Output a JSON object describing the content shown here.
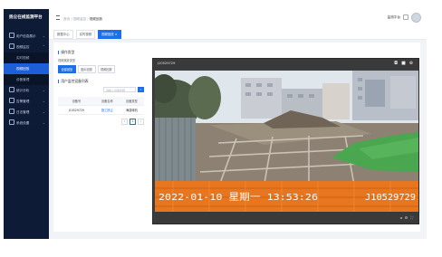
{
  "app": {
    "title": "扬尘在线监测平台"
  },
  "sidebar": {
    "items": [
      {
        "icon": "home-icon",
        "label": "用户信息展示",
        "sub": []
      },
      {
        "icon": "monitor-icon",
        "label": "视频监控",
        "sub": [
          {
            "label": "实时视频",
            "active": false
          },
          {
            "label": "视频回放",
            "active": true
          },
          {
            "label": "设备管理",
            "active": false
          }
        ]
      },
      {
        "icon": "chart-icon",
        "label": "统计分析",
        "sub": []
      },
      {
        "icon": "alarm-icon",
        "label": "告警管理",
        "sub": []
      },
      {
        "icon": "log-icon",
        "label": "日志管理",
        "sub": []
      },
      {
        "icon": "system-icon",
        "label": "系统设置",
        "sub": []
      }
    ]
  },
  "header": {
    "breadcrumb": [
      "首页",
      "视频监控",
      "视频回放"
    ],
    "user_label": "监测平台",
    "user_icons": [
      "screen-icon",
      "bell-icon"
    ]
  },
  "tabs": [
    {
      "label": "数据中心",
      "active": false
    },
    {
      "label": "实时视频",
      "active": false
    },
    {
      "label": "视频回放 ×",
      "active": true
    }
  ],
  "left": {
    "section1_title": "操作类型",
    "section1_sub": "视频播放类型",
    "type_buttons": [
      {
        "label": "全部回放",
        "active": true
      },
      {
        "label": "图片回放",
        "active": false
      },
      {
        "label": "视频回放",
        "active": false
      }
    ],
    "section2_title": "用户监控设备列表",
    "search_placeholder": "请输入设备名称",
    "search_icon": "search-icon",
    "table": {
      "headers": [
        "设备号",
        "设备名称",
        "设备类型"
      ],
      "rows": [
        [
          "J10529729",
          "施工扬尘",
          "海康球机"
        ]
      ]
    },
    "pager": [
      "‹",
      "1",
      "›"
    ]
  },
  "video": {
    "title": "J10529729",
    "osd_time": "2022-01-10 星期一 13:53:26",
    "osd_id": "J10529729",
    "controls": [
      "camera-icon",
      "record-icon",
      "zoom-icon"
    ],
    "footer_controls": [
      "volume-icon",
      "speed-icon",
      "fullscreen-icon"
    ]
  }
}
